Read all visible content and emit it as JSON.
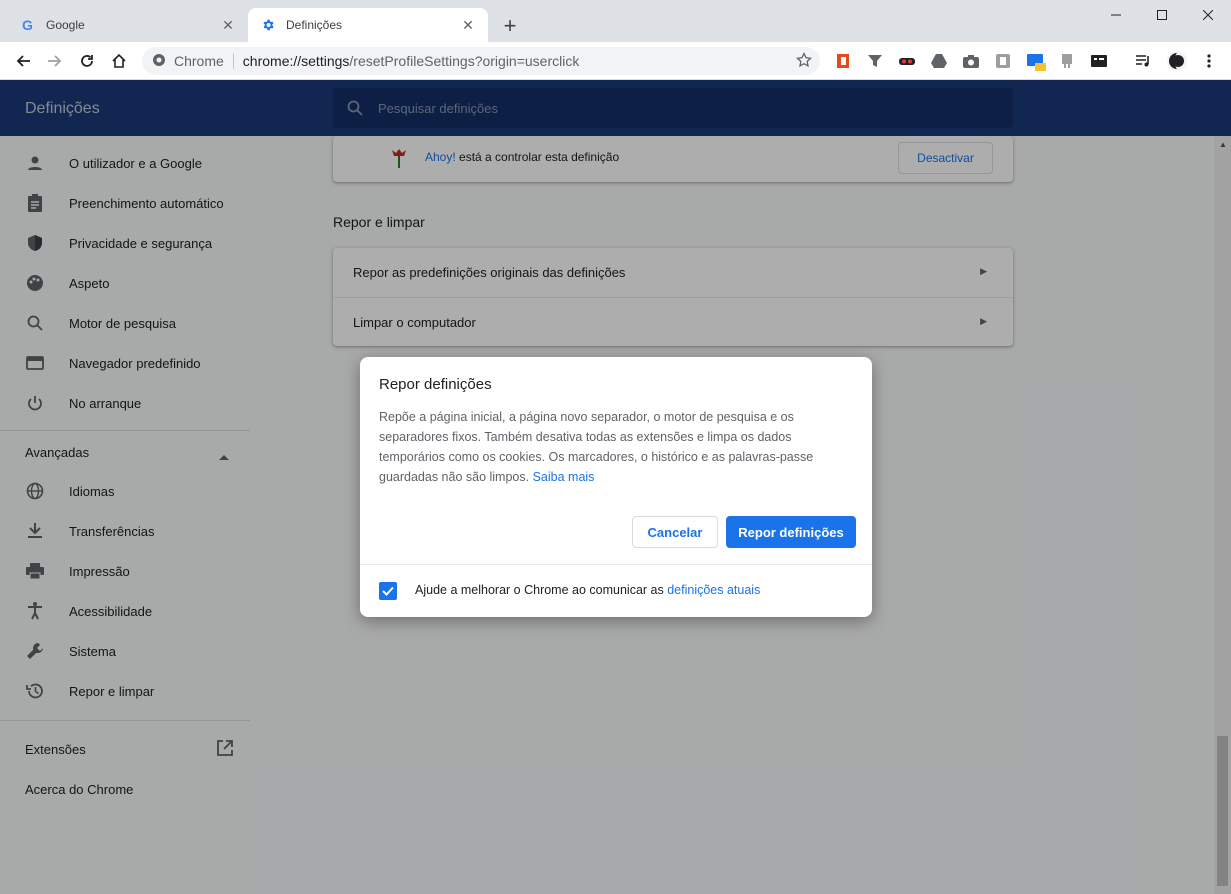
{
  "tabs": [
    {
      "title": "Google",
      "icon": "google-g-icon"
    },
    {
      "title": "Definições",
      "icon": "settings-gear-icon"
    }
  ],
  "toolbar": {
    "omnibox_chip": "Chrome",
    "url_host": "chrome://settings",
    "url_rest": "/resetProfileSettings?origin=userclick"
  },
  "header": {
    "title": "Definições",
    "search_placeholder": "Pesquisar definições"
  },
  "sidebar": {
    "items": [
      {
        "label": "O utilizador e a Google",
        "icon": "person-icon"
      },
      {
        "label": "Preenchimento automático",
        "icon": "clipboard-icon"
      },
      {
        "label": "Privacidade e segurança",
        "icon": "shield-icon"
      },
      {
        "label": "Aspeto",
        "icon": "palette-icon"
      },
      {
        "label": "Motor de pesquisa",
        "icon": "search-icon"
      },
      {
        "label": "Navegador predefinido",
        "icon": "browser-window-icon"
      },
      {
        "label": "No arranque",
        "icon": "power-icon"
      }
    ],
    "advanced_label": "Avançadas",
    "advanced_items": [
      {
        "label": "Idiomas",
        "icon": "globe-icon"
      },
      {
        "label": "Transferências",
        "icon": "download-icon"
      },
      {
        "label": "Impressão",
        "icon": "printer-icon"
      },
      {
        "label": "Acessibilidade",
        "icon": "accessibility-icon"
      },
      {
        "label": "Sistema",
        "icon": "wrench-icon"
      },
      {
        "label": "Repor e limpar",
        "icon": "history-icon"
      }
    ],
    "extensions_label": "Extensões",
    "about_label": "Acerca do Chrome"
  },
  "main": {
    "ahoy_link": "Ahoy!",
    "ahoy_text": " está a controlar esta definição",
    "deactivate_label": "Desactivar",
    "section_title": "Repor e limpar",
    "rows": [
      {
        "label": "Repor as predefinições originais das definições"
      },
      {
        "label": "Limpar o computador"
      }
    ]
  },
  "dialog": {
    "title": "Repor definições",
    "body": "Repõe a página inicial, a página novo separador, o motor de pesquisa e os separadores fixos. Também desativa todas as extensões e limpa os dados temporários como os cookies. Os marcadores, o histórico e as palavras-passe guardadas não são limpos.",
    "learn_more": "Saiba mais",
    "cancel_label": "Cancelar",
    "reset_label": "Repor definições",
    "checkbox_checked": true,
    "footer_text": "Ajude a melhorar o Chrome ao comunicar as ",
    "footer_link": "definições atuais"
  },
  "colors": {
    "accent": "#1a73e8",
    "header_bg": "#1a3a7a"
  }
}
